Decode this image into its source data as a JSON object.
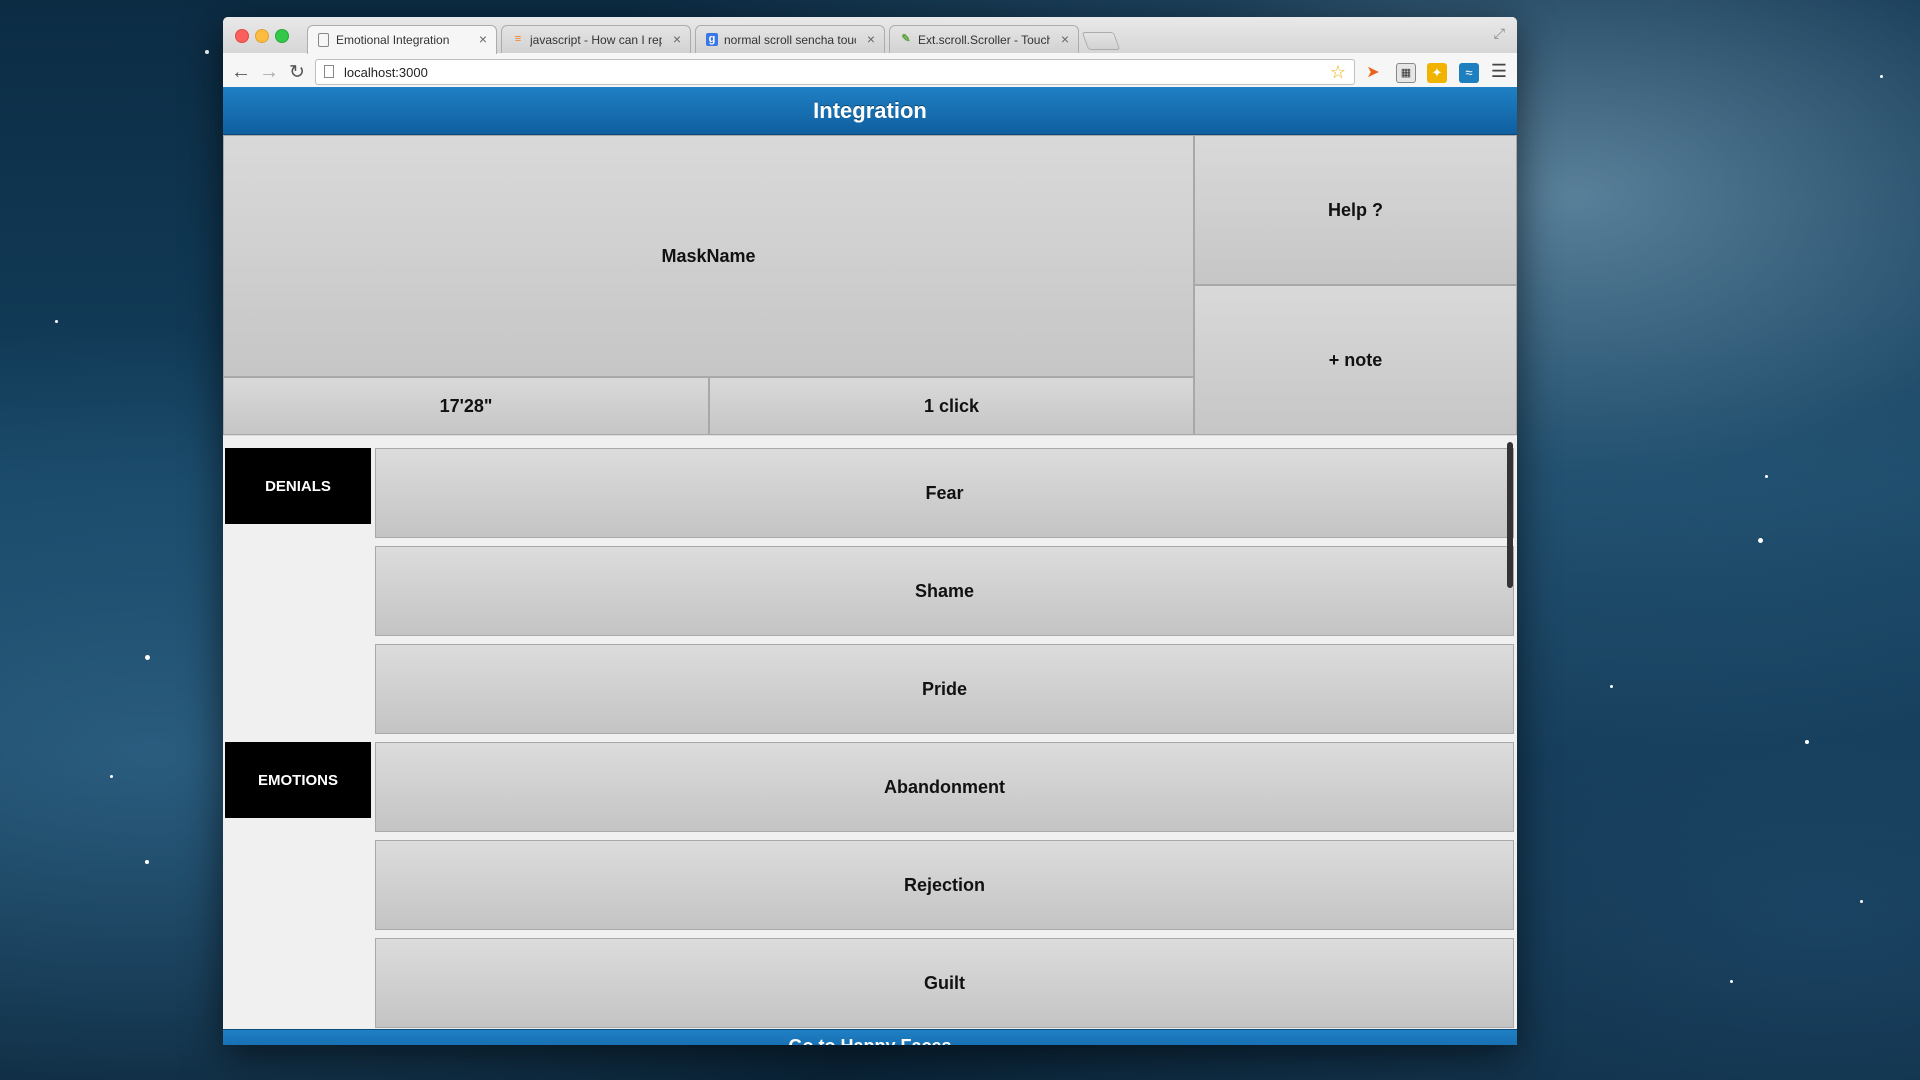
{
  "browser": {
    "tabs": [
      {
        "title": "Emotional Integration",
        "icon": "page-icon",
        "active": true
      },
      {
        "title": "javascript - How can I repl",
        "icon": "stackoverflow-icon",
        "active": false
      },
      {
        "title": "normal scroll sencha touch",
        "icon": "google-icon",
        "active": false
      },
      {
        "title": "Ext.scroll.Scroller - Touch",
        "icon": "sencha-icon",
        "active": false
      }
    ],
    "url": "localhost:3000"
  },
  "app": {
    "header_title": "Integration",
    "mask_name": "MaskName",
    "help_label": "Help ?",
    "note_label": "+ note",
    "timer": "17'28\"",
    "clicks": "1 click",
    "sections": [
      {
        "label": "DENIALS",
        "items": [
          "Fear",
          "Shame",
          "Pride"
        ]
      },
      {
        "label": "EMOTIONS",
        "items": [
          "Abandonment",
          "Rejection",
          "Guilt"
        ]
      }
    ],
    "footer_label": "Go to Happy Faces"
  },
  "colors": {
    "header_blue": "#1a72b5",
    "button_gray": "#cfcfcf",
    "section_label_bg": "#000000"
  }
}
